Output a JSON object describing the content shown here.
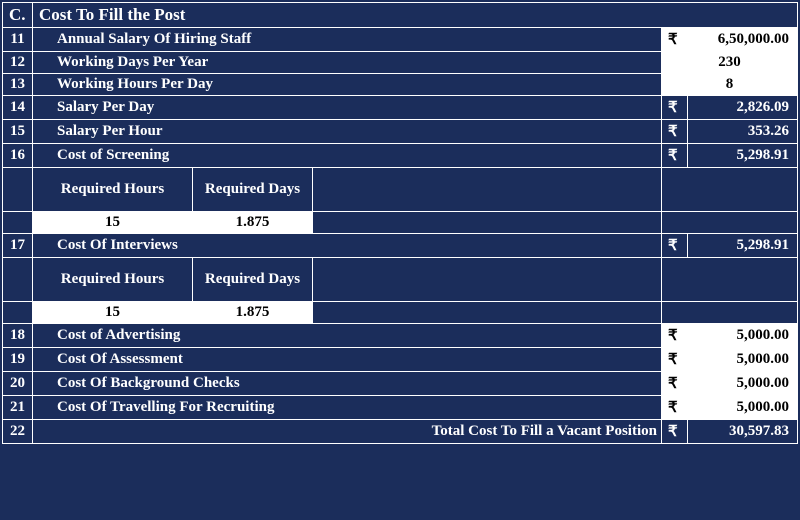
{
  "section": {
    "letter": "C.",
    "title": "Cost To Fill the Post"
  },
  "currency": "₹",
  "rows": {
    "r11": {
      "num": "11",
      "label": "Annual Salary Of Hiring Staff",
      "value": "6,50,000.00"
    },
    "r12": {
      "num": "12",
      "label": "Working Days Per Year",
      "value": "230"
    },
    "r13": {
      "num": "13",
      "label": "Working Hours Per Day",
      "value": "8"
    },
    "r14": {
      "num": "14",
      "label": "Salary Per Day",
      "value": "2,826.09"
    },
    "r15": {
      "num": "15",
      "label": "Salary Per Hour",
      "value": "353.26"
    },
    "r16": {
      "num": "16",
      "label": "Cost of Screening",
      "value": "5,298.91",
      "sub": {
        "h1": "Required Hours",
        "h2": "Required Days",
        "v1": "15",
        "v2": "1.875"
      }
    },
    "r17": {
      "num": "17",
      "label": "Cost Of Interviews",
      "value": "5,298.91",
      "sub": {
        "h1": "Required Hours",
        "h2": "Required Days",
        "v1": "15",
        "v2": "1.875"
      }
    },
    "r18": {
      "num": "18",
      "label": "Cost of Advertising",
      "value": "5,000.00"
    },
    "r19": {
      "num": "19",
      "label": "Cost Of Assessment",
      "value": "5,000.00"
    },
    "r20": {
      "num": "20",
      "label": "Cost Of Background Checks",
      "value": "5,000.00"
    },
    "r21": {
      "num": "21",
      "label": "Cost Of Travelling For Recruiting",
      "value": "5,000.00"
    },
    "r22": {
      "num": "22",
      "label": "Total Cost To Fill a Vacant Position",
      "value": "30,597.83"
    }
  }
}
